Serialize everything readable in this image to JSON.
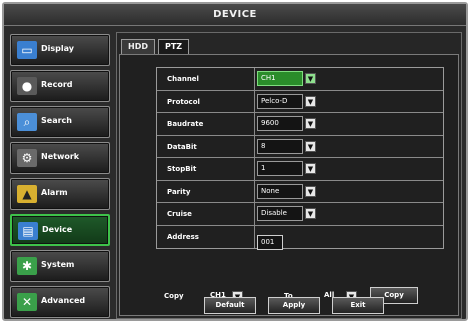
{
  "window": {
    "title": "DEVICE"
  },
  "sidebar": {
    "items": [
      {
        "label": "Display",
        "icon": "monitor-icon",
        "glyph": "▭",
        "color": "#3a7fd0",
        "active": false
      },
      {
        "label": "Record",
        "icon": "camera-icon",
        "glyph": "●",
        "color": "#5a5a5a",
        "active": false
      },
      {
        "label": "Search",
        "icon": "magnifier-icon",
        "glyph": "⌕",
        "color": "#4b8fd8",
        "active": false
      },
      {
        "label": "Network",
        "icon": "network-icon",
        "glyph": "⚙",
        "color": "#6a6a6a",
        "active": false
      },
      {
        "label": "Alarm",
        "icon": "alarm-icon",
        "glyph": "▲",
        "color": "#d8b030",
        "active": false
      },
      {
        "label": "Device",
        "icon": "device-icon",
        "glyph": "▤",
        "color": "#3a7fd0",
        "active": true
      },
      {
        "label": "System",
        "icon": "system-icon",
        "glyph": "✱",
        "color": "#3aa04a",
        "active": false
      },
      {
        "label": "Advanced",
        "icon": "advanced-icon",
        "glyph": "✕",
        "color": "#3aa04a",
        "active": false
      }
    ]
  },
  "tabs": [
    {
      "label": "HDD",
      "active": false
    },
    {
      "label": "PTZ",
      "active": true
    }
  ],
  "ptz": {
    "channel": {
      "label": "Channel",
      "value": "CH1"
    },
    "protocol": {
      "label": "Protocol",
      "value": "Pelco-D"
    },
    "baudrate": {
      "label": "Baudrate",
      "value": "9600"
    },
    "databit": {
      "label": "DataBit",
      "value": "8"
    },
    "stopbit": {
      "label": "StopBit",
      "value": "1"
    },
    "parity": {
      "label": "Parity",
      "value": "None"
    },
    "cruise": {
      "label": "Cruise",
      "value": "Disable"
    },
    "address": {
      "label": "Address",
      "value": "001"
    }
  },
  "copy": {
    "copy_label": "Copy",
    "from_value": "CH1",
    "to_label": "To",
    "to_value": "All",
    "copy_button": "Copy"
  },
  "footer": {
    "default_button": "Default",
    "apply_button": "Apply",
    "exit_button": "Exit"
  },
  "colors": {
    "active_border": "#3ec24a",
    "highlight_select": "#2a8c2a"
  }
}
